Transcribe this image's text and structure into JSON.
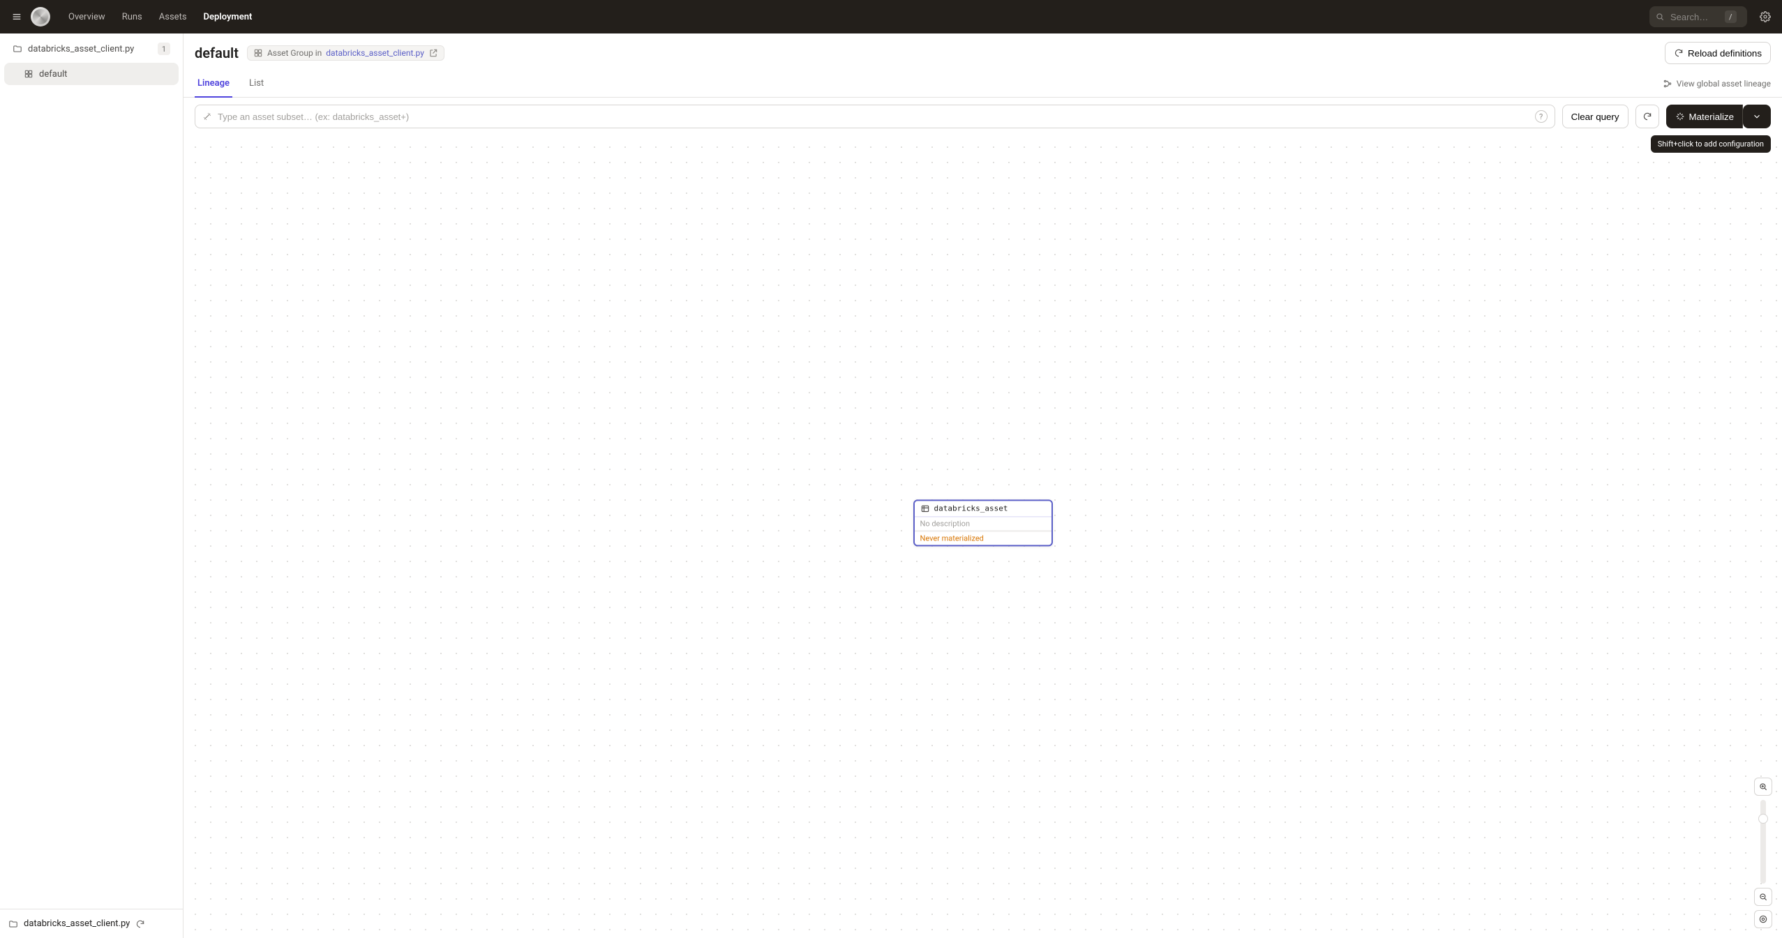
{
  "nav": {
    "links": [
      "Overview",
      "Runs",
      "Assets",
      "Deployment"
    ],
    "active_index": 3,
    "search_placeholder": "Search…",
    "search_shortcut": "/"
  },
  "sidebar": {
    "location": {
      "name": "databricks_asset_client.py",
      "count": "1"
    },
    "groups": [
      {
        "name": "default"
      }
    ],
    "footer_location": "databricks_asset_client.py"
  },
  "header": {
    "title": "default",
    "chip_prefix": "Asset Group in ",
    "chip_link": "databricks_asset_client.py",
    "reload_label": "Reload definitions"
  },
  "tabs": {
    "items": [
      "Lineage",
      "List"
    ],
    "active_index": 0,
    "view_lineage_label": "View global asset lineage"
  },
  "toolbar": {
    "query_placeholder": "Type an asset subset… (ex: databricks_asset+)",
    "clear_query_label": "Clear query",
    "materialize_label": "Materialize",
    "materialize_tooltip": "Shift+click to add configuration"
  },
  "canvas": {
    "asset": {
      "name": "databricks_asset",
      "description": "No description",
      "status": "Never materialized"
    }
  }
}
